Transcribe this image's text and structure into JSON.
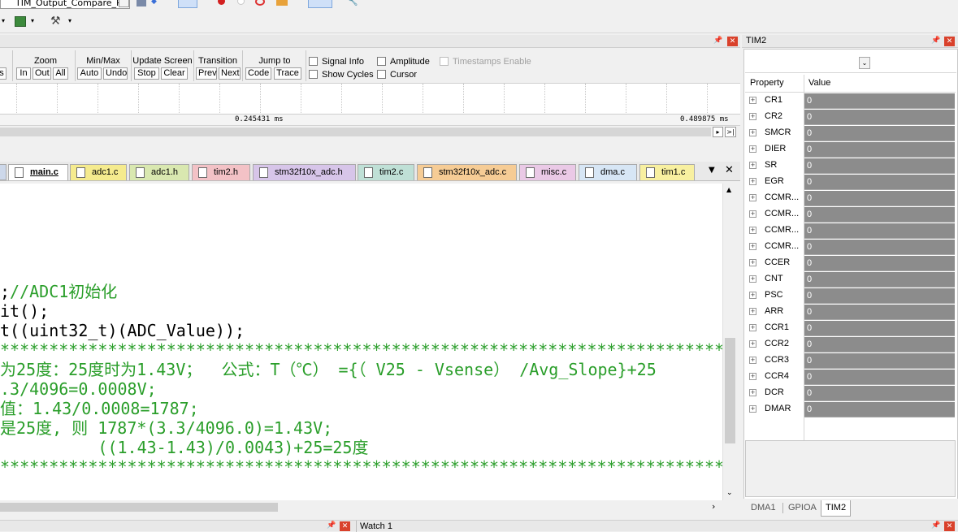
{
  "toolbar": {
    "target_combo": "TIM_Output_Compare_P"
  },
  "logic_analyzer": {
    "groups": [
      {
        "title": "Zoom",
        "buttons": [
          "In",
          "Out",
          "All"
        ]
      },
      {
        "title": "Min/Max",
        "buttons": [
          "Auto",
          "Undo"
        ]
      },
      {
        "title": "Update Screen",
        "buttons": [
          "Stop",
          "Clear"
        ]
      },
      {
        "title": "Transition",
        "buttons": [
          "Prev",
          "Next"
        ]
      },
      {
        "title": "Jump to",
        "buttons": [
          "Code",
          "Trace"
        ]
      }
    ],
    "left_partial_button": "s",
    "checkboxes": {
      "signal_info": "Signal Info",
      "show_cycles": "Show Cycles",
      "amplitude": "Amplitude",
      "cursor": "Cursor",
      "timestamps": "Timestamps Enable"
    },
    "time_mid": "0.245431 ms",
    "time_end": "0.489875 ms"
  },
  "editor": {
    "tabs": [
      {
        "label": "main.c",
        "color": "#d5def0",
        "active": true
      },
      {
        "label": "adc1.c",
        "color": "#f5eb8e"
      },
      {
        "label": "adc1.h",
        "color": "#d9e8b0"
      },
      {
        "label": "tim2.h",
        "color": "#f3c2c6"
      },
      {
        "label": "stm32f10x_adc.h",
        "color": "#d7c5e9"
      },
      {
        "label": "tim2.c",
        "color": "#bfe0d6"
      },
      {
        "label": "stm32f10x_adc.c",
        "color": "#f6cc95"
      },
      {
        "label": "misc.c",
        "color": "#eac9e6"
      },
      {
        "label": "dma.c",
        "color": "#d7e6f5"
      },
      {
        "label": "tim1.c",
        "color": "#f8f0a0"
      }
    ],
    "lines": [
      {
        "code": ";",
        "comment": "//ADC1初始化"
      },
      {
        "code": "it();",
        "comment": ""
      },
      {
        "code": "t((uint32_t)(ADC_Value));",
        "comment": ""
      },
      {
        "code": "",
        "comment": "**************************************************************************"
      },
      {
        "code": "",
        "comment": "为25度：25度时为1.43V；  公式：T（℃） ={（ V25 - Vsense） /Avg_Slope}+25"
      },
      {
        "code": "",
        "comment": ".3/4096=0.0008V;"
      },
      {
        "code": "",
        "comment": "值：1.43/0.0008=1787;"
      },
      {
        "code": "",
        "comment": "是25度, 则 1787*(3.3/4096.0)=1.43V;"
      },
      {
        "code": "",
        "comment": "          ((1.43-1.43)/0.0043)+25=25度"
      },
      {
        "code": "",
        "comment": "**************************************************************************"
      }
    ]
  },
  "register_panel": {
    "title": "TIM2",
    "col_property": "Property",
    "col_value": "Value",
    "registers": [
      {
        "name": "CR1",
        "value": "0"
      },
      {
        "name": "CR2",
        "value": "0"
      },
      {
        "name": "SMCR",
        "value": "0"
      },
      {
        "name": "DIER",
        "value": "0"
      },
      {
        "name": "SR",
        "value": "0"
      },
      {
        "name": "EGR",
        "value": "0"
      },
      {
        "name": "CCMR...",
        "value": "0"
      },
      {
        "name": "CCMR...",
        "value": "0"
      },
      {
        "name": "CCMR...",
        "value": "0"
      },
      {
        "name": "CCMR...",
        "value": "0"
      },
      {
        "name": "CCER",
        "value": "0"
      },
      {
        "name": "CNT",
        "value": "0"
      },
      {
        "name": "PSC",
        "value": "0"
      },
      {
        "name": "ARR",
        "value": "0"
      },
      {
        "name": "CCR1",
        "value": "0"
      },
      {
        "name": "CCR2",
        "value": "0"
      },
      {
        "name": "CCR3",
        "value": "0"
      },
      {
        "name": "CCR4",
        "value": "0"
      },
      {
        "name": "DCR",
        "value": "0"
      },
      {
        "name": "DMAR",
        "value": "0"
      }
    ],
    "bottom_tabs": [
      {
        "label": "DMA1"
      },
      {
        "label": "GPIOA"
      },
      {
        "label": "TIM2",
        "active": true
      }
    ]
  },
  "watch": {
    "title": "Watch 1"
  }
}
